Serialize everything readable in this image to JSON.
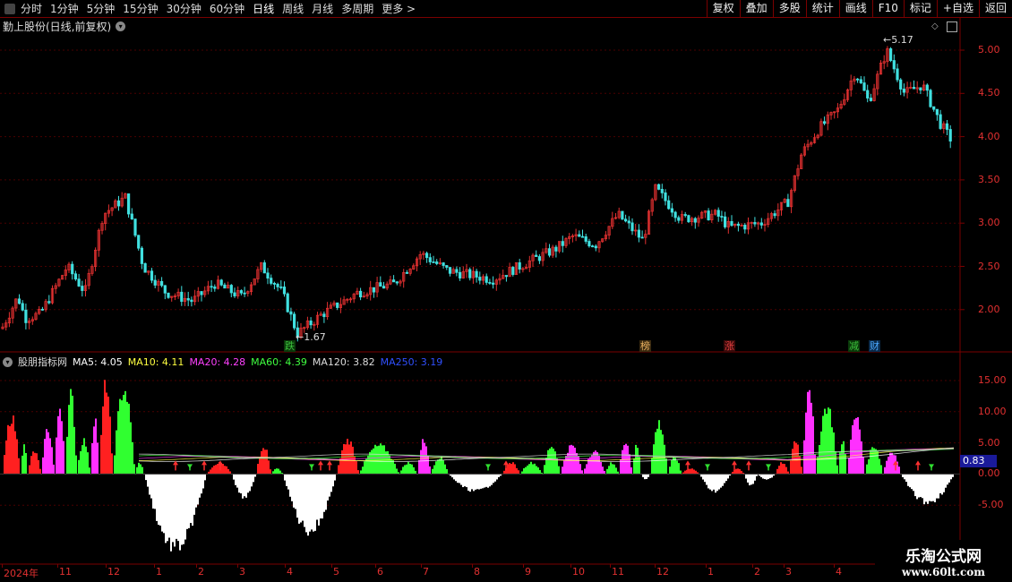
{
  "toolbar": {
    "timeframes": [
      "分时",
      "1分钟",
      "5分钟",
      "15分钟",
      "30分钟",
      "60分钟",
      "日线",
      "周线",
      "月线",
      "多周期",
      "更多"
    ],
    "active": "日线",
    "right_buttons": [
      "复权",
      "叠加",
      "多股",
      "统计",
      "画线",
      "F10",
      "标记",
      "+自选",
      "返回"
    ]
  },
  "stock": {
    "title": "勤上股份(日线,前复权)"
  },
  "price_axis": [
    "5.00",
    "4.50",
    "4.00",
    "3.50",
    "3.00",
    "2.50",
    "2.00"
  ],
  "annotations": {
    "high": "5.17",
    "low": "1.67"
  },
  "markers": [
    {
      "text": "跌",
      "color": "#3cbf3c"
    },
    {
      "text": "榜",
      "color": "#e8b060"
    },
    {
      "text": "涨",
      "color": "#e84040"
    },
    {
      "text": "减",
      "color": "#3cbf3c"
    },
    {
      "text": "财",
      "color": "#4aa8ff"
    }
  ],
  "indicator": {
    "name": "股朋指标网",
    "ma": [
      {
        "label": "MA5: 4.05",
        "color": "#ffffff"
      },
      {
        "label": "MA10: 4.11",
        "color": "#ffff40"
      },
      {
        "label": "MA20: 4.28",
        "color": "#ff40ff"
      },
      {
        "label": "MA60: 4.39",
        "color": "#40ff40"
      },
      {
        "label": "MA120: 3.82",
        "color": "#dddddd"
      },
      {
        "label": "MA250: 3.19",
        "color": "#3050ff"
      }
    ],
    "axis": [
      "15.00",
      "10.00",
      "5.00",
      "0.00",
      "-5.00"
    ],
    "current": "0.83"
  },
  "date_axis": [
    "2024年",
    "11",
    "12",
    "1",
    "2",
    "3",
    "4",
    "5",
    "6",
    "7",
    "8",
    "9",
    "10",
    "11",
    "12",
    "1",
    "2",
    "3",
    "4"
  ],
  "watermark": {
    "line1": "乐淘公式网",
    "line2": "www.60lt.com"
  },
  "colors": {
    "up": "#e23030",
    "down": "#40e0e0",
    "bar_red": "#ff2020",
    "bar_green": "#30ff30",
    "bar_magenta": "#ff30ff",
    "bar_white": "#ffffff",
    "grid": "#7a0000"
  }
}
